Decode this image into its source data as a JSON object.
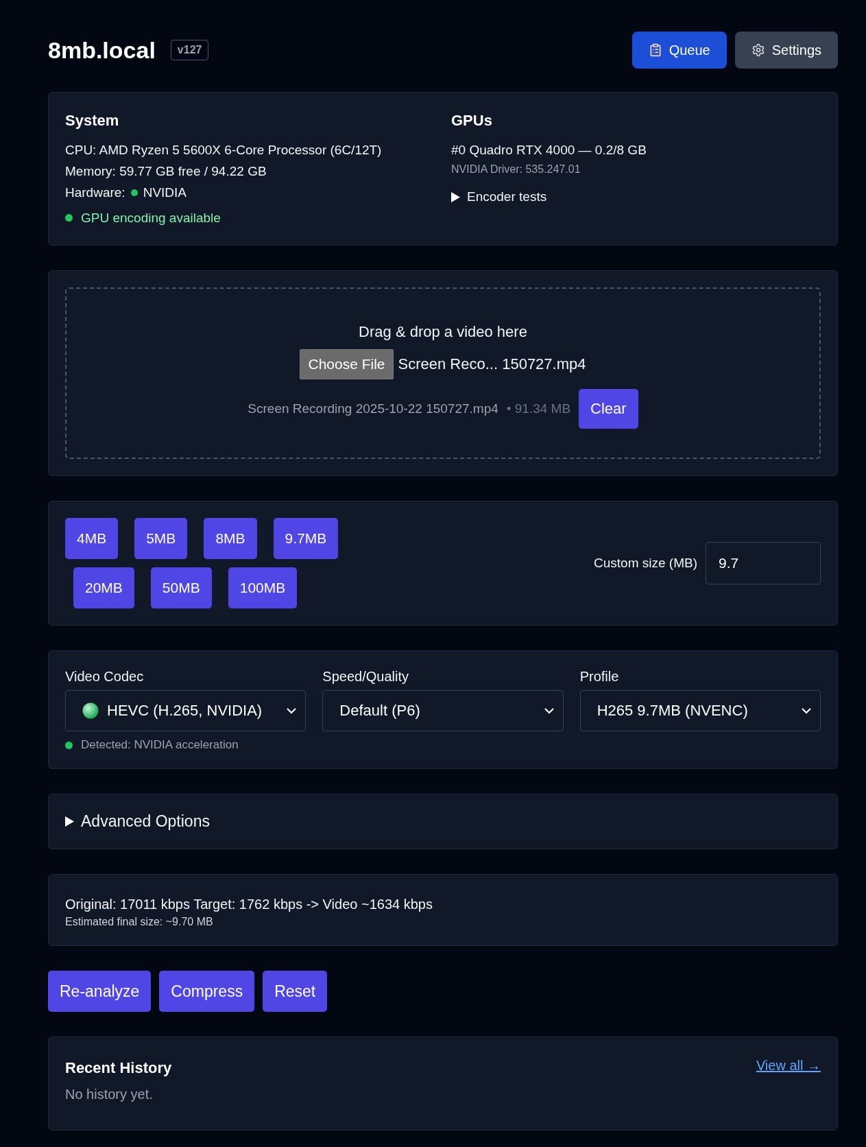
{
  "header": {
    "title": "8mb.local",
    "version": "v127",
    "buttons": [
      {
        "kind": "queue",
        "label": "Queue"
      },
      {
        "kind": "settings",
        "label": "Settings"
      }
    ]
  },
  "system": {
    "title": "System",
    "lines": [
      "CPU: AMD Ryzen 5 5600X 6-Core Processor (6C/12T)",
      "Memory: 59.77 GB free / 94.22 GB"
    ],
    "hardware_label": "Hardware:",
    "hardware_value": "NVIDIA",
    "gpu_status": "GPU encoding available"
  },
  "gpus": {
    "title": "GPUs",
    "items": [
      {
        "name": "#0 Quadro RTX 4000 — 0.2/8 GB",
        "driver": "NVIDIA Driver: 535.247.01"
      }
    ],
    "encoder_tests": {
      "label": "Encoder tests",
      "expanded": false
    }
  },
  "upload": {
    "prompt": "Drag & drop a video here",
    "choose_button": "Choose File",
    "chosen_file": "Screen Reco... 150727.mp4",
    "file_name": "Screen Recording 2025-10-22 150727.mp4",
    "file_size": "• 91.34 MB",
    "clear_button": "Clear"
  },
  "sizes": {
    "rows": [
      [
        "4MB",
        "5MB",
        "8MB",
        "9.7MB"
      ],
      [
        "20MB",
        "50MB",
        "100MB"
      ]
    ],
    "custom_label": "Custom size (MB)",
    "custom_value": "9.7"
  },
  "encoding": {
    "fields": [
      {
        "label": "Video Codec",
        "value": "HEVC (H.265, NVIDIA)",
        "kind": "codec"
      },
      {
        "label": "Speed/Quality",
        "value": "Default (P6)",
        "kind": "plain"
      },
      {
        "label": "Profile",
        "value": "H265 9.7MB (NVENC)",
        "kind": "plain"
      }
    ],
    "detected": "Detected: NVIDIA acceleration"
  },
  "advanced": {
    "label": "Advanced Options",
    "expanded": false
  },
  "estimate": {
    "line": "Original: 17011 kbps Target: 1762 kbps -> Video ~1634 kbps",
    "final": "Estimated final size: ~9.70 MB"
  },
  "actions": [
    "Re-analyze",
    "Compress",
    "Reset"
  ],
  "history": {
    "title": "Recent History",
    "link": "View all →",
    "empty": "No history yet."
  }
}
